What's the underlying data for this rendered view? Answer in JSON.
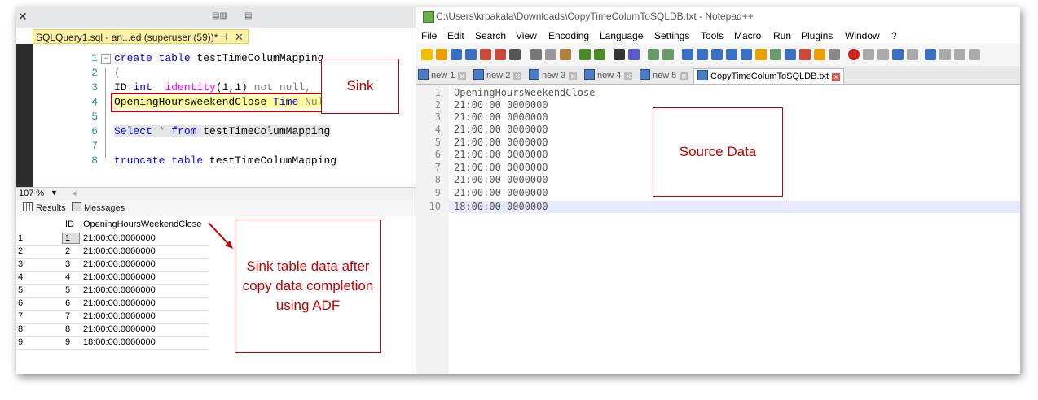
{
  "ssms": {
    "tab_title": "SQLQuery1.sql - an...ed (superuser (59))*",
    "pin_symbol": "⊣",
    "close_symbol": "✕",
    "close_window": "✕",
    "line_numbers": [
      "1",
      "2",
      "3",
      "4",
      "5",
      "6",
      "7",
      "8"
    ],
    "code": {
      "l1_kw": "create table",
      "l1_rest": " testTimeColumMapping",
      "l2": "(",
      "l3_a": "ID ",
      "l3_kw1": "int",
      "l3_b": "  ",
      "l3_kw2": "identity",
      "l3_c": "(1,1)",
      "l3_d": " not null,",
      "l4_a": "OpeningHoursWeekendClose ",
      "l4_kw": "Time",
      "l4_b": " ",
      "l4_c": "Null",
      "l4_d": ")",
      "l6_kw1": "Select",
      "l6_a": " * ",
      "l6_kw2": "from",
      "l6_b": " testTimeColumMapping",
      "l8_kw": "truncate table",
      "l8_b": " testTimeColumMapping"
    },
    "zoom": "107 %",
    "results_tab": "Results",
    "messages_tab": "Messages",
    "result_header_id": "ID",
    "result_header_col": "OpeningHoursWeekendClose",
    "rows": [
      {
        "n": "1",
        "id": "1",
        "val": "21:00:00.0000000"
      },
      {
        "n": "2",
        "id": "2",
        "val": "21:00:00.0000000"
      },
      {
        "n": "3",
        "id": "3",
        "val": "21:00:00.0000000"
      },
      {
        "n": "4",
        "id": "4",
        "val": "21:00:00.0000000"
      },
      {
        "n": "5",
        "id": "5",
        "val": "21:00:00.0000000"
      },
      {
        "n": "6",
        "id": "6",
        "val": "21:00:00.0000000"
      },
      {
        "n": "7",
        "id": "7",
        "val": "21:00:00.0000000"
      },
      {
        "n": "8",
        "id": "8",
        "val": "21:00:00.0000000"
      },
      {
        "n": "9",
        "id": "9",
        "val": "18:00:00.0000000"
      }
    ]
  },
  "npp": {
    "title": "C:\\Users\\krpakala\\Downloads\\CopyTimeColumToSQLDB.txt - Notepad++",
    "menu": [
      "File",
      "Edit",
      "Search",
      "View",
      "Encoding",
      "Language",
      "Settings",
      "Tools",
      "Macro",
      "Run",
      "Plugins",
      "Window",
      "?"
    ],
    "tabs": [
      "new 1",
      "new 2",
      "new 3",
      "new 4",
      "new 5",
      "CopyTimeColumToSQLDB.txt"
    ],
    "lines": [
      {
        "n": "1",
        "t": "OpeningHoursWeekendClose"
      },
      {
        "n": "2",
        "t": "21:00:00 0000000"
      },
      {
        "n": "3",
        "t": "21:00:00 0000000"
      },
      {
        "n": "4",
        "t": "21:00:00 0000000"
      },
      {
        "n": "5",
        "t": "21:00:00 0000000"
      },
      {
        "n": "6",
        "t": "21:00:00 0000000"
      },
      {
        "n": "7",
        "t": "21:00:00 0000000"
      },
      {
        "n": "8",
        "t": "21:00:00 0000000"
      },
      {
        "n": "9",
        "t": "21:00:00 0000000"
      },
      {
        "n": "10",
        "t": "18:00:00 0000000"
      }
    ]
  },
  "annotations": {
    "sink": "Sink",
    "source_data": "Source Data",
    "sink_table_note": "Sink table data after copy data completion using ADF"
  },
  "colors": {
    "annotation_red": "#c00000",
    "keyword_blue": "#0000ff",
    "tab_yellow": "#fff2a8"
  }
}
